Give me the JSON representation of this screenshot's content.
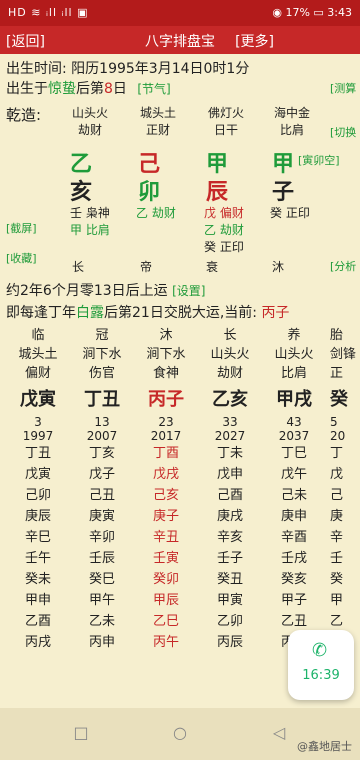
{
  "status": {
    "left": "HD ≋ ᵢll ᵢll ▣",
    "right": "◉ 17% ▭ 3:43"
  },
  "title": {
    "back": "[返回]",
    "title": "八字排盘宝",
    "more": "[更多]"
  },
  "birth": {
    "line1": "出生时间: 阳历1995年3月14日0时1分",
    "line2_a": "出生于",
    "line2_b": "惊蛰",
    "line2_c": "后第",
    "line2_d": "8",
    "line2_e": "日",
    "line2_f": "[节气]",
    "side_btn": "[测算"
  },
  "bazi": {
    "label": "乾造:",
    "side_btns": [
      "[切换",
      "[截屏]",
      "[收藏]",
      "[分析"
    ],
    "kongwang": "[寅卯空]",
    "pillars": [
      {
        "nayin": "山头火",
        "shishen": "劫财",
        "gan": "乙",
        "zhi": "亥",
        "canggan": [
          "壬 枭神",
          "甲 比肩"
        ],
        "state": "长"
      },
      {
        "nayin": "城头土",
        "shishen": "正财",
        "gan": "己",
        "zhi": "卯",
        "canggan": [
          "乙 劫财"
        ],
        "state": "帝"
      },
      {
        "nayin": "佛灯火",
        "shishen": "日干",
        "gan": "甲",
        "zhi": "辰",
        "canggan": [
          "戊 偏财",
          "乙 劫财",
          "癸 正印"
        ],
        "state": "衰"
      },
      {
        "nayin": "海中金",
        "shishen": "比肩",
        "gan": "甲",
        "zhi": "子",
        "canggan": [
          "癸 正印"
        ],
        "state": "沐"
      }
    ]
  },
  "qiyun": {
    "text": "约2年6个月零13日后上运",
    "btn": "[设置]"
  },
  "jiaoyun": {
    "a": "即每逢丁年",
    "b": "白露",
    "c": "后第21日交脱大运,当前: ",
    "d": "丙子"
  },
  "dayun": [
    {
      "state": "临",
      "nayin": "城头土",
      "shishen": "偏财",
      "ganzhi": "戊寅",
      "age": "3",
      "year": "1997",
      "years": [
        "丁丑",
        "戊寅",
        "己卯",
        "庚辰",
        "辛巳",
        "壬午",
        "癸未",
        "甲申",
        "乙酉",
        "丙戌"
      ]
    },
    {
      "state": "冠",
      "nayin": "涧下水",
      "shishen": "伤官",
      "ganzhi": "丁丑",
      "age": "13",
      "year": "2007",
      "years": [
        "丁亥",
        "戊子",
        "己丑",
        "庚寅",
        "辛卯",
        "壬辰",
        "癸巳",
        "甲午",
        "乙未",
        "丙申"
      ]
    },
    {
      "state": "沐",
      "nayin": "涧下水",
      "shishen": "食神",
      "ganzhi": "丙子",
      "age": "23",
      "year": "2017",
      "years": [
        "丁酉",
        "戊戌",
        "己亥",
        "庚子",
        "辛丑",
        "壬寅",
        "癸卯",
        "甲辰",
        "乙巳",
        "丙午"
      ]
    },
    {
      "state": "长",
      "nayin": "山头火",
      "shishen": "劫财",
      "ganzhi": "乙亥",
      "age": "33",
      "year": "2027",
      "years": [
        "丁未",
        "戊申",
        "己酉",
        "庚戌",
        "辛亥",
        "壬子",
        "癸丑",
        "甲寅",
        "乙卯",
        "丙辰"
      ]
    },
    {
      "state": "养",
      "nayin": "山头火",
      "shishen": "比肩",
      "ganzhi": "甲戌",
      "age": "43",
      "year": "2037",
      "years": [
        "丁巳",
        "戊午",
        "己未",
        "庚申",
        "辛酉",
        "壬戌",
        "癸亥",
        "甲子",
        "乙丑",
        "丙寅"
      ]
    },
    {
      "state": "胎",
      "nayin": "剑锋",
      "shishen": "正",
      "ganzhi": "癸",
      "age": "5",
      "year": "20",
      "years": [
        "丁",
        "戊",
        "己",
        "庚",
        "辛",
        "壬",
        "癸",
        "甲",
        "乙",
        "丙"
      ]
    }
  ],
  "fab": {
    "time": "16:39"
  },
  "watermark": "@鑫地居士"
}
